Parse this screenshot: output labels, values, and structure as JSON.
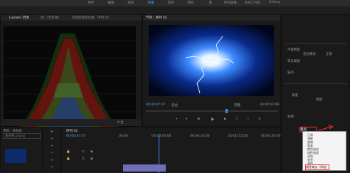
{
  "menubar": {
    "items": [
      "组件",
      "编辑",
      "颜色",
      "效果",
      "音频",
      "图形",
      "库",
      "所有面板",
      "本地工作区",
      "Editing"
    ]
  },
  "source_panel": {
    "tabs": [
      "Lumetri 范围",
      "源：(无剪辑)",
      "音频剪辑混合器：序列 02"
    ],
    "scope_label": "8 位"
  },
  "program_panel": {
    "title": "节目：序列 02",
    "timecode_in": "00:00:07:07",
    "fit": "适合",
    "quality": "完整",
    "timecode_out": "00:00:12:06"
  },
  "effects_panel": {
    "opacity_label": "不透明度",
    "blend_label": "混合模式",
    "blend_value": "正常",
    "scale_label": "等比缩放",
    "anchor_label": "锚点",
    "blend_dropdown_value": "叠加",
    "section_label": "效果",
    "stretch_label": "高度",
    "scale_mode_label": "缩放"
  },
  "blend_menu": {
    "items": [
      "正常",
      "溶解",
      "变暗",
      "相乘",
      "颜色加深",
      "线性加深",
      "深色",
      "变亮",
      "滤色",
      "颜色减淡",
      "线性减淡（添加）",
      "浅色",
      "叠加",
      "柔光"
    ],
    "selected": "线性减淡（添加）"
  },
  "project_panel": {
    "title": "项目：未命名",
    "search_placeholder": "未命名.prproj"
  },
  "timeline_panel": {
    "title": "序列 02",
    "timecode": "00:00:07:07",
    "ruler": [
      "00:00",
      "00:00:05:00",
      "00:00:10:00",
      "00:00:15:00",
      "00:00:20:00"
    ]
  },
  "colors": {
    "accent": "#4da0ff",
    "highlight": "#ff2a2a",
    "playhead": "#3d8bff"
  }
}
